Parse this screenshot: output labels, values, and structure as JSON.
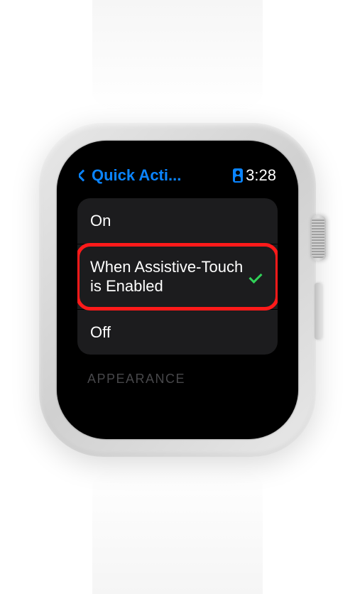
{
  "statusBar": {
    "backTitle": "Quick Acti...",
    "time": "3:28"
  },
  "options": [
    {
      "label": "On",
      "selected": false,
      "highlighted": false
    },
    {
      "label": "When Assistive‐Touch is Enabled",
      "selected": true,
      "highlighted": true
    },
    {
      "label": "Off",
      "selected": false,
      "highlighted": false
    }
  ],
  "sectionHeader": "APPEARANCE"
}
